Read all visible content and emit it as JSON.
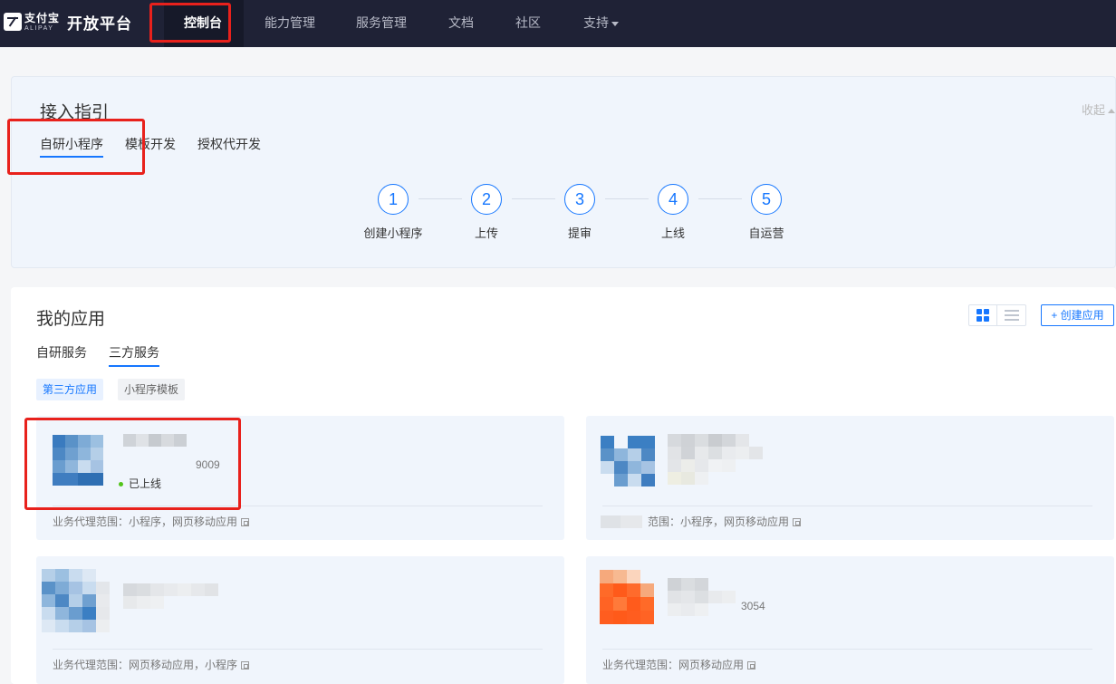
{
  "brand": {
    "logo_cn": "支付宝",
    "logo_en": "ALIPAY",
    "platform_title": "开放平台"
  },
  "nav": {
    "items": [
      "控制台",
      "能力管理",
      "服务管理",
      "文档",
      "社区",
      "支持"
    ],
    "active": "控制台"
  },
  "guide": {
    "title": "接入指引",
    "collapse_label": "收起",
    "tabs": [
      "自研小程序",
      "模板开发",
      "授权代开发"
    ],
    "active_tab": "自研小程序",
    "steps": [
      {
        "num": "1",
        "label": "创建小程序"
      },
      {
        "num": "2",
        "label": "上传"
      },
      {
        "num": "3",
        "label": "提审"
      },
      {
        "num": "4",
        "label": "上线"
      },
      {
        "num": "5",
        "label": "自运营"
      }
    ]
  },
  "apps": {
    "title": "我的应用",
    "create_button": "+ 创建应用",
    "tabs": [
      "自研服务",
      "三方服务"
    ],
    "active_tab": "三方服务",
    "filters": [
      "第三方应用",
      "小程序模板"
    ],
    "active_filter": "第三方应用",
    "tiles": [
      {
        "id_suffix": "9009",
        "status": "已上线",
        "scope": "业务代理范围：小程序，网页移动应用"
      },
      {
        "scope": "范围：小程序，网页移动应用"
      },
      {
        "scope": "业务代理范围：网页移动应用，小程序"
      },
      {
        "id_suffix": "3054",
        "scope": "业务代理范围：网页移动应用"
      }
    ]
  },
  "colors": {
    "nav_bg": "#1f2236",
    "accent": "#1677ff",
    "annotation_red": "#e8211c",
    "status_online": "#52c41a"
  }
}
